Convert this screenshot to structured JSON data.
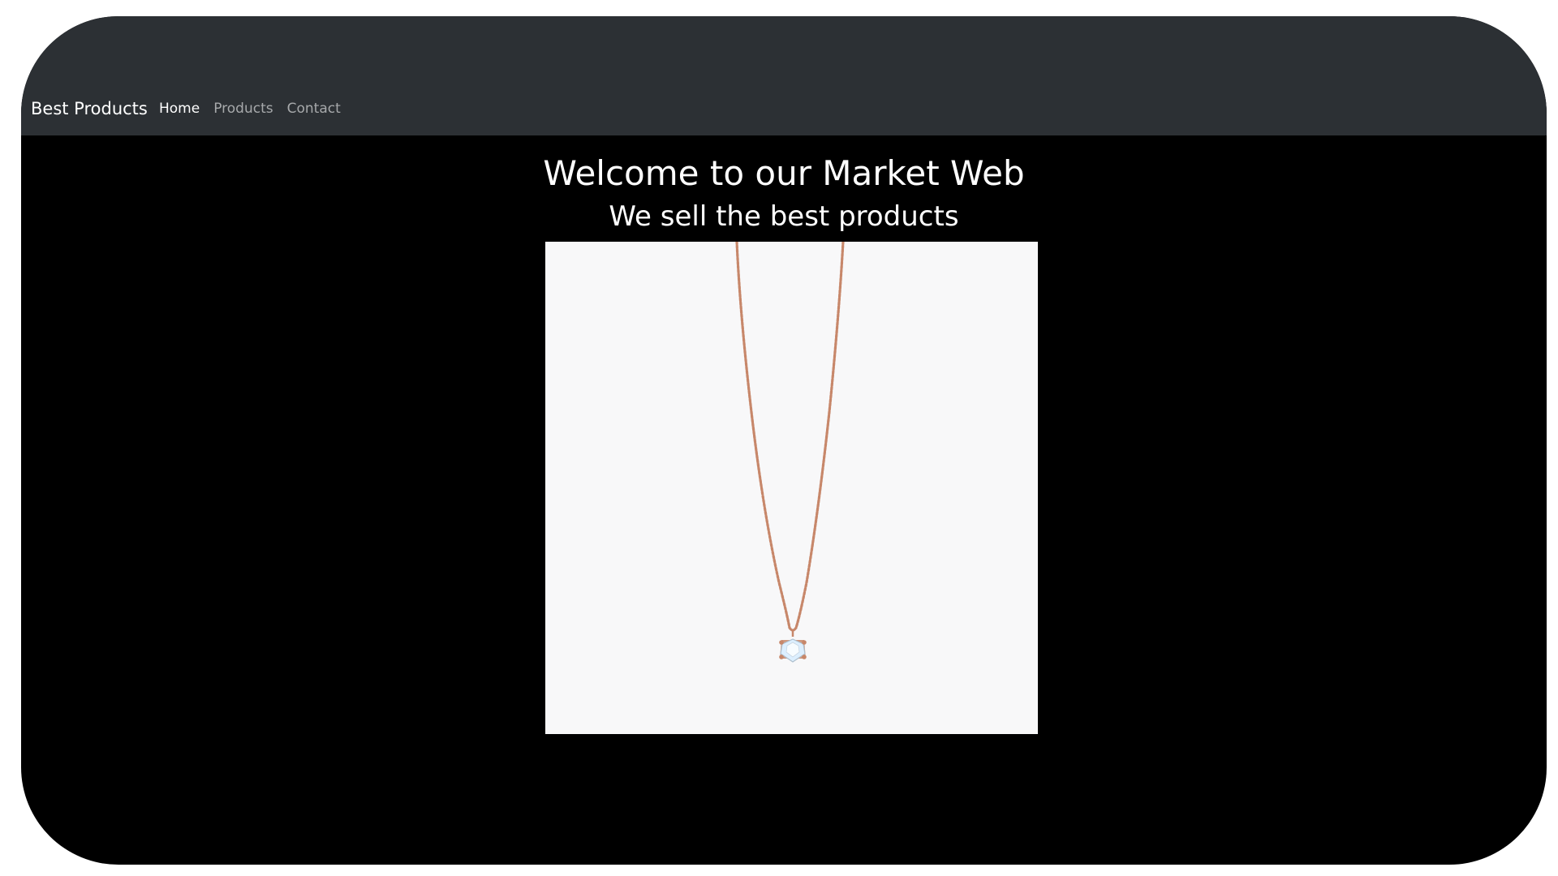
{
  "navbar": {
    "brand": "Best Products",
    "links": [
      {
        "label": "Home",
        "active": true
      },
      {
        "label": "Products",
        "active": false
      },
      {
        "label": "Contact",
        "active": false
      }
    ]
  },
  "hero": {
    "title": "Welcome to our Market Web",
    "subtitle": "We sell the best products"
  },
  "product_image": {
    "icon": "necklace-pendant-image",
    "background_color": "#f8f8f9",
    "chain_color": "#c7876a"
  },
  "colors": {
    "navbar_bg": "#2c3034",
    "page_bg": "#000000",
    "text": "#ffffff",
    "nav_inactive": "#a7a9ab"
  }
}
